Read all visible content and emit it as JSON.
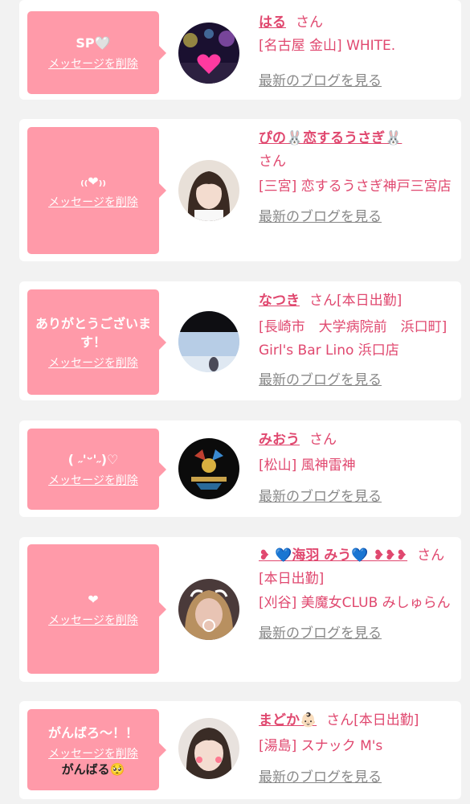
{
  "delete_label": "メッセージを削除",
  "blog_label": "最新のブログを見る",
  "san": "さん",
  "entries": [
    {
      "message": "SP🤍",
      "name": "はる",
      "status": "",
      "shop": "[名古屋 金山] WHITE.",
      "extra": ""
    },
    {
      "message": "₍₍❤︎₎₎",
      "name": "ぴの🐰恋するうさぎ🐰",
      "status": "",
      "shop": "[三宮] 恋するうさぎ神戸三宮店",
      "extra": ""
    },
    {
      "message": "ありがとうございます！",
      "name": "なつき",
      "status": "[本日出勤]",
      "shop": "[長崎市　大学病院前　浜口町] Girl's Bar Lino 浜口店",
      "extra": ""
    },
    {
      "message": "( ˶'ᵕ'˶)♡",
      "name": "みおう",
      "status": "",
      "shop": "[松山] 風神雷神",
      "extra": ""
    },
    {
      "message": "❤︎",
      "name": "❥ 💙海羽 みう💙 ❥❥❥",
      "status": "[本日出勤]",
      "shop": "[刈谷] 美魔女CLUB みしゅらん",
      "extra": ""
    },
    {
      "message": "がんばろ〜！！",
      "name": "まどか👶🏻",
      "status": "[本日出勤]",
      "shop": "[湯島] スナック M's",
      "extra": "がんばる🥺"
    }
  ],
  "colors": {
    "accent": "#e0486f",
    "bubble": "#ff9aa9",
    "link_gray": "#888888"
  }
}
